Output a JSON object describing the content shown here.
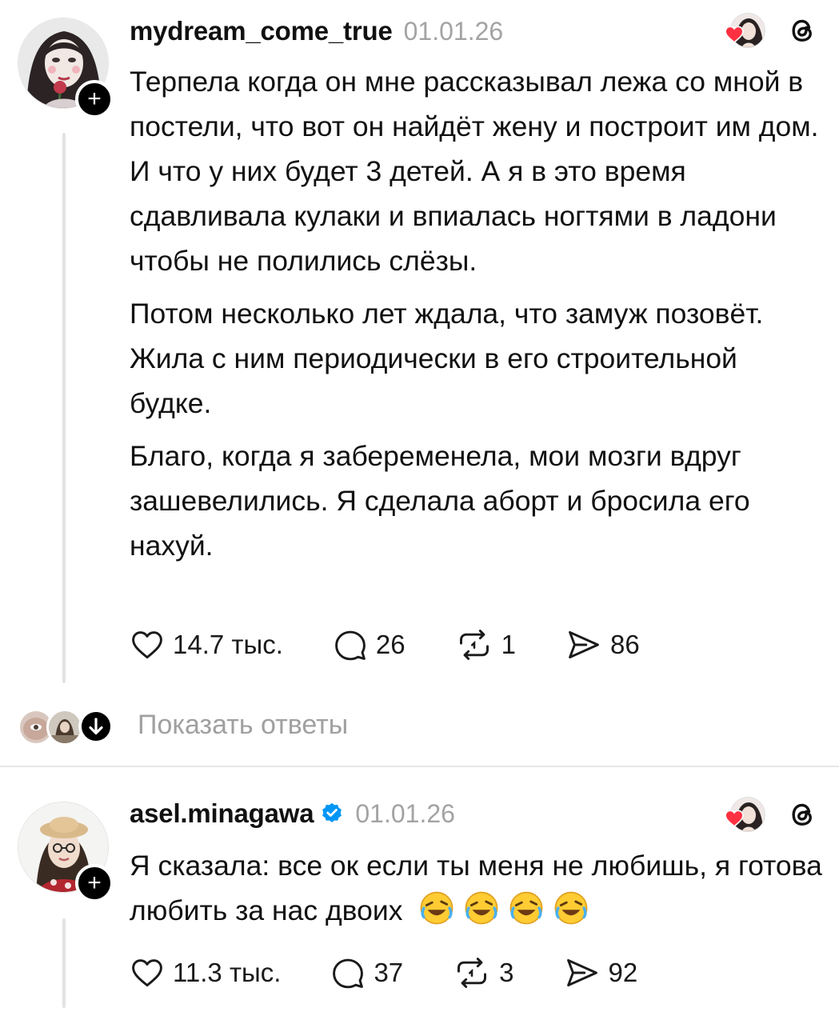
{
  "posts": [
    {
      "username": "mydream_come_true",
      "date": "01.01.26",
      "verified": false,
      "paragraphs": [
        "Терпела когда он мне рассказывал лежа со мной в постели, что вот он найдёт жену и построит им дом. И что у них будет 3 детей. А я в это время сдавливала кулаки и впиалась ногтями в ладони чтобы не полились слёзы.",
        "Потом несколько лет ждала, что замуж позовёт. Жила с ним периодически в его строительной будке.",
        "Благо, когда я забеременела, мои мозги вдруг зашевелились. Я сделала аборт и бросила его нахуй."
      ],
      "likes": "14.7 тыс.",
      "comments": "26",
      "reposts": "1",
      "shares": "86"
    },
    {
      "username": "asel.minagawa",
      "date": "01.01.26",
      "verified": true,
      "paragraphs": [
        "Я сказала: все ок если ты меня не любишь, я готова любить за нас двоих"
      ],
      "emoji": "🤣🤣🤣🤣",
      "likes": "11.3 тыс.",
      "comments": "37",
      "reposts": "3",
      "shares": "92"
    }
  ],
  "show_replies_label": "Показать ответы",
  "icons": {
    "follow": "plus-icon",
    "liked_by": "heart-icon",
    "app": "threads-icon",
    "like": "heart-outline-icon",
    "comment": "comment-icon",
    "repost": "repost-icon",
    "share": "share-icon",
    "expand": "arrow-down-icon",
    "verified": "verified-badge-icon"
  },
  "colors": {
    "text": "#111111",
    "muted": "#a3a3a3",
    "verified": "#0095f6",
    "heart": "#ff3040",
    "divider": "#e6e6e6"
  }
}
